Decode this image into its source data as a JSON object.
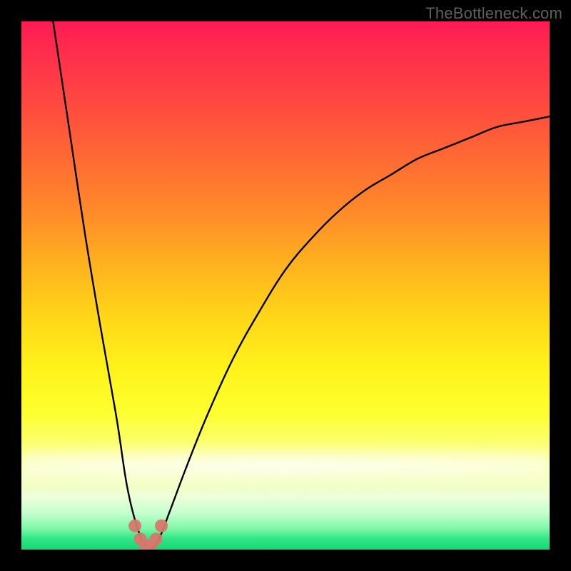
{
  "watermark": "TheBottleneck.com",
  "colors": {
    "gradient_top": "#ff1a54",
    "gradient_mid": "#ffd618",
    "gradient_bottom": "#14d874",
    "curve": "#000000",
    "marker": "#d6786d",
    "frame_bg": "#000000"
  },
  "chart_data": {
    "type": "line",
    "title": "",
    "xlabel": "",
    "ylabel": "",
    "xlim": [
      0,
      100
    ],
    "ylim": [
      0,
      100
    ],
    "note": "y ≈ bottleneck% (0 at bottom/green, 100 at top/red). Minimum ≈ 0 near x ≈ 24.",
    "series": [
      {
        "name": "bottleneck-curve",
        "x": [
          6,
          9,
          12,
          15,
          18,
          20,
          22,
          24,
          26,
          28,
          31,
          35,
          40,
          45,
          50,
          55,
          60,
          65,
          70,
          75,
          80,
          85,
          90,
          95,
          100
        ],
        "y": [
          100,
          80,
          60,
          42,
          25,
          12,
          4,
          0,
          2,
          7,
          15,
          25,
          36,
          45,
          53,
          59,
          64,
          68,
          71,
          74,
          76,
          78,
          80,
          81,
          82
        ]
      }
    ],
    "markers": {
      "name": "min-region",
      "x": [
        21.5,
        22.5,
        23.5,
        24.5,
        25.5,
        26.5
      ],
      "y": [
        4.5,
        2.0,
        0.8,
        0.8,
        2.0,
        4.5
      ]
    }
  }
}
